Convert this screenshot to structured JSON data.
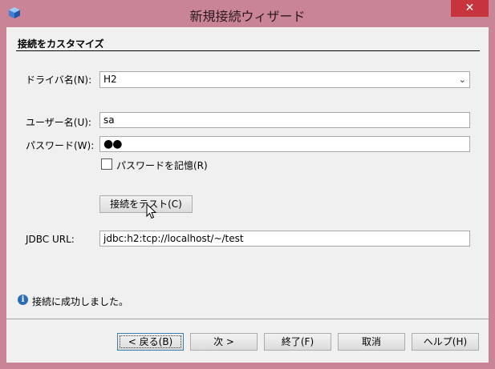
{
  "window": {
    "title": "新規接続ウィザード",
    "close_glyph": "✕"
  },
  "section": {
    "title": "接続をカスタマイズ"
  },
  "driver": {
    "label": "ドライバ名(N):",
    "value": "H2"
  },
  "user": {
    "label": "ユーザー名(U):",
    "value": "sa"
  },
  "password": {
    "label": "パスワード(W):",
    "value": "●●"
  },
  "remember": {
    "label": "パスワードを記憶(R)",
    "checked": false
  },
  "test_button": {
    "label": "接続をテスト(C)"
  },
  "jdbc": {
    "label": "JDBC URL:",
    "value": "jdbc:h2:tcp://localhost/~/test"
  },
  "status": {
    "text": "接続に成功しました。"
  },
  "nav": {
    "back": "< 戻る(B)",
    "next": "次 >",
    "finish": "終了(F)",
    "cancel": "取消",
    "help": "ヘルプ(H)"
  },
  "colors": {
    "frame": "#c98496",
    "close": "#c7343d",
    "info": "#2b6db5"
  }
}
